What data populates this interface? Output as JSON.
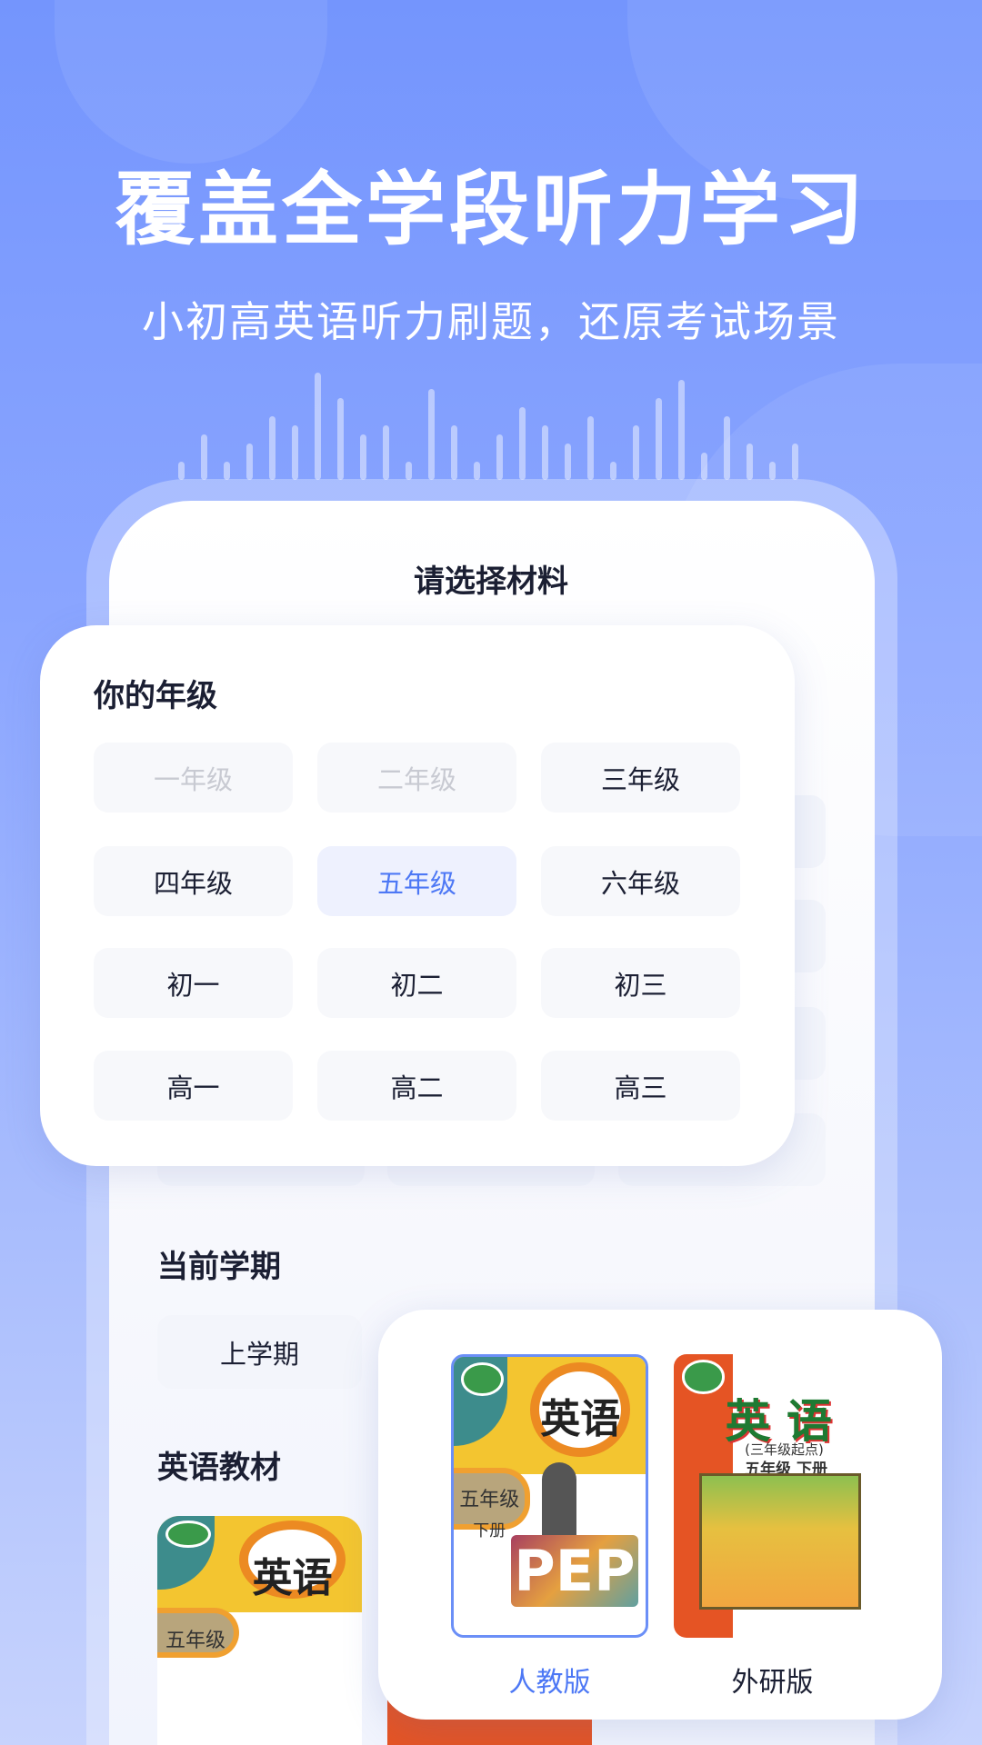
{
  "header": {
    "title": "覆盖全学段听力学习",
    "subtitle": "小初高英语听力刷题，还原考试场景"
  },
  "main": {
    "title": "请选择材料"
  },
  "grade": {
    "label": "你的年级",
    "selected": "五年级",
    "options": [
      {
        "label": "一年级",
        "state": "disabled"
      },
      {
        "label": "二年级",
        "state": "disabled"
      },
      {
        "label": "三年级",
        "state": "normal"
      },
      {
        "label": "四年级",
        "state": "normal"
      },
      {
        "label": "五年级",
        "state": "selected"
      },
      {
        "label": "六年级",
        "state": "normal"
      },
      {
        "label": "初一",
        "state": "normal"
      },
      {
        "label": "初二",
        "state": "normal"
      },
      {
        "label": "初三",
        "state": "normal"
      },
      {
        "label": "高一",
        "state": "normal"
      },
      {
        "label": "高二",
        "state": "normal"
      },
      {
        "label": "高三",
        "state": "normal"
      }
    ]
  },
  "term": {
    "label": "当前学期",
    "options": [
      "上学期"
    ]
  },
  "textbook": {
    "label": "英语教材",
    "selected": "人教版",
    "options": [
      {
        "label": "人教版",
        "cover_title": "英语",
        "cover_grade": "五年级",
        "cover_volume": "下册",
        "cover_mark": "PEP"
      },
      {
        "label": "外研版",
        "cover_title": "英 语",
        "cover_sub": "(三年级起点)",
        "cover_grade": "五年级 下册"
      }
    ]
  },
  "colors": {
    "accent": "#4d78f5",
    "text": "#1b1f33",
    "disabled": "#c8cad2",
    "background": "#7f9cfe"
  }
}
